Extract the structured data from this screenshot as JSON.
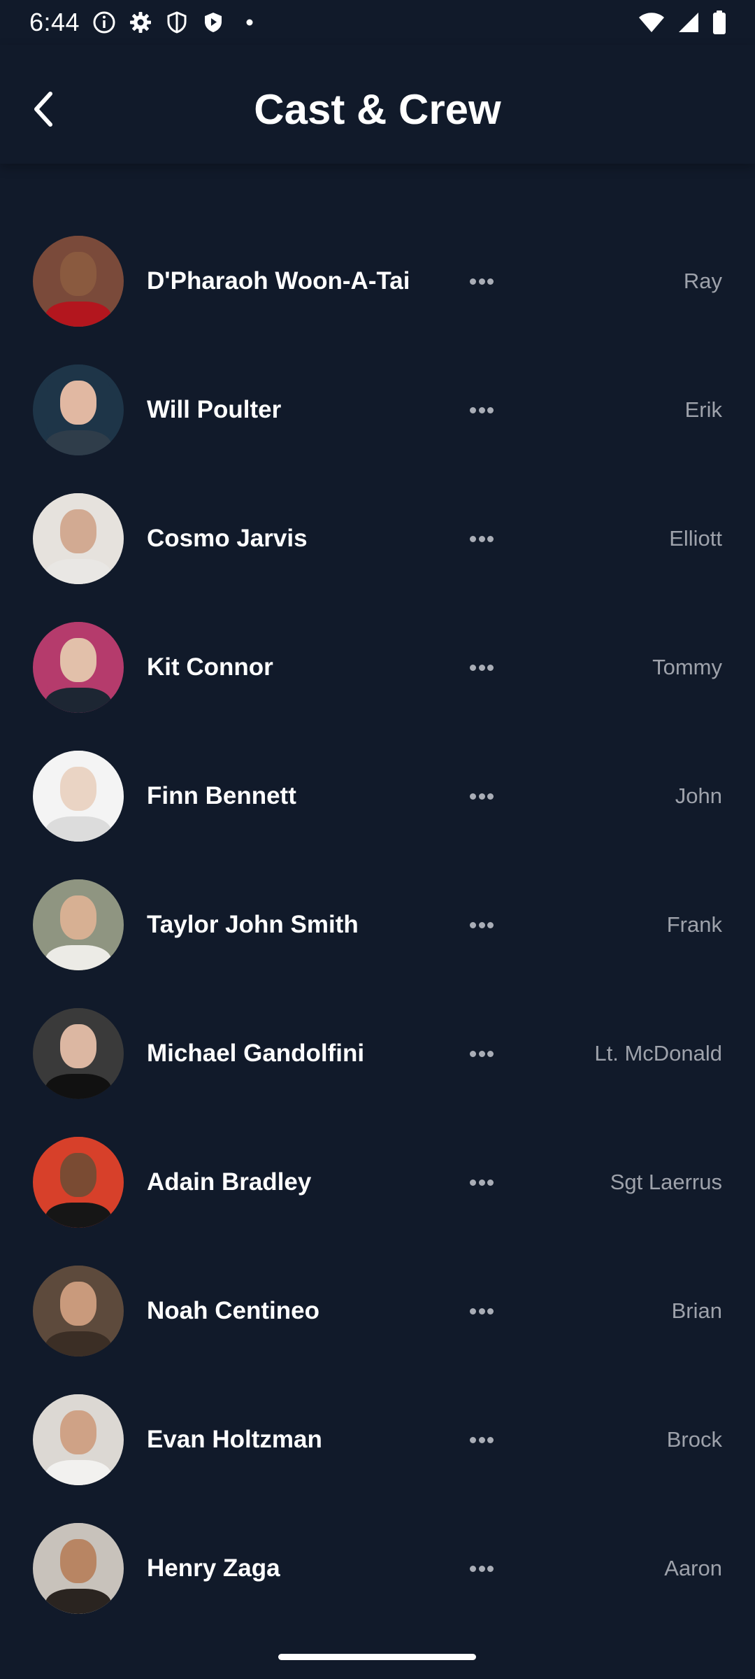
{
  "status_bar": {
    "time": "6:44",
    "left_icons": [
      "info-icon",
      "gear-icon",
      "shield-icon",
      "play-shield-icon",
      "dot-icon"
    ],
    "right_icons": [
      "wifi-icon",
      "signal-icon",
      "battery-icon"
    ]
  },
  "header": {
    "title": "Cast & Crew",
    "back_icon": "chevron-left-icon"
  },
  "cast": [
    {
      "name": "D'Pharaoh Woon-A-Tai",
      "character": "Ray",
      "avatar_bg": "#7a4a3a",
      "skin": "#8a5a3f",
      "shirt": "#b3161e"
    },
    {
      "name": "Will Poulter",
      "character": "Erik",
      "avatar_bg": "#1e3548",
      "skin": "#e1b8a2",
      "shirt": "#2f3d4a"
    },
    {
      "name": "Cosmo Jarvis",
      "character": "Elliott",
      "avatar_bg": "#e6e2dd",
      "skin": "#d2aa92",
      "shirt": "#e9e7e4"
    },
    {
      "name": "Kit Connor",
      "character": "Tommy",
      "avatar_bg": "#b53b6c",
      "skin": "#e2c0aa",
      "shirt": "#1d2633"
    },
    {
      "name": "Finn Bennett",
      "character": "John",
      "avatar_bg": "#f4f4f4",
      "skin": "#ead4c4",
      "shirt": "#dcdcdc"
    },
    {
      "name": "Taylor John Smith",
      "character": "Frank",
      "avatar_bg": "#8f9581",
      "skin": "#d7b093",
      "shirt": "#ecebe6"
    },
    {
      "name": "Michael Gandolfini",
      "character": "Lt. McDonald",
      "avatar_bg": "#3a3a3a",
      "skin": "#dcb7a2",
      "shirt": "#111111"
    },
    {
      "name": "Adain Bradley",
      "character": "Sgt Laerrus",
      "avatar_bg": "#d7402a",
      "skin": "#7a4b33",
      "shirt": "#161616"
    },
    {
      "name": "Noah Centineo",
      "character": "Brian",
      "avatar_bg": "#5d4a3c",
      "skin": "#c99a7c",
      "shirt": "#3b2e25"
    },
    {
      "name": "Evan Holtzman",
      "character": "Brock",
      "avatar_bg": "#dcd8d3",
      "skin": "#cfa286",
      "shirt": "#f2f1ef"
    },
    {
      "name": "Henry Zaga",
      "character": "Aaron",
      "avatar_bg": "#c8c2bb",
      "skin": "#b88563",
      "shirt": "#2a2420"
    }
  ]
}
